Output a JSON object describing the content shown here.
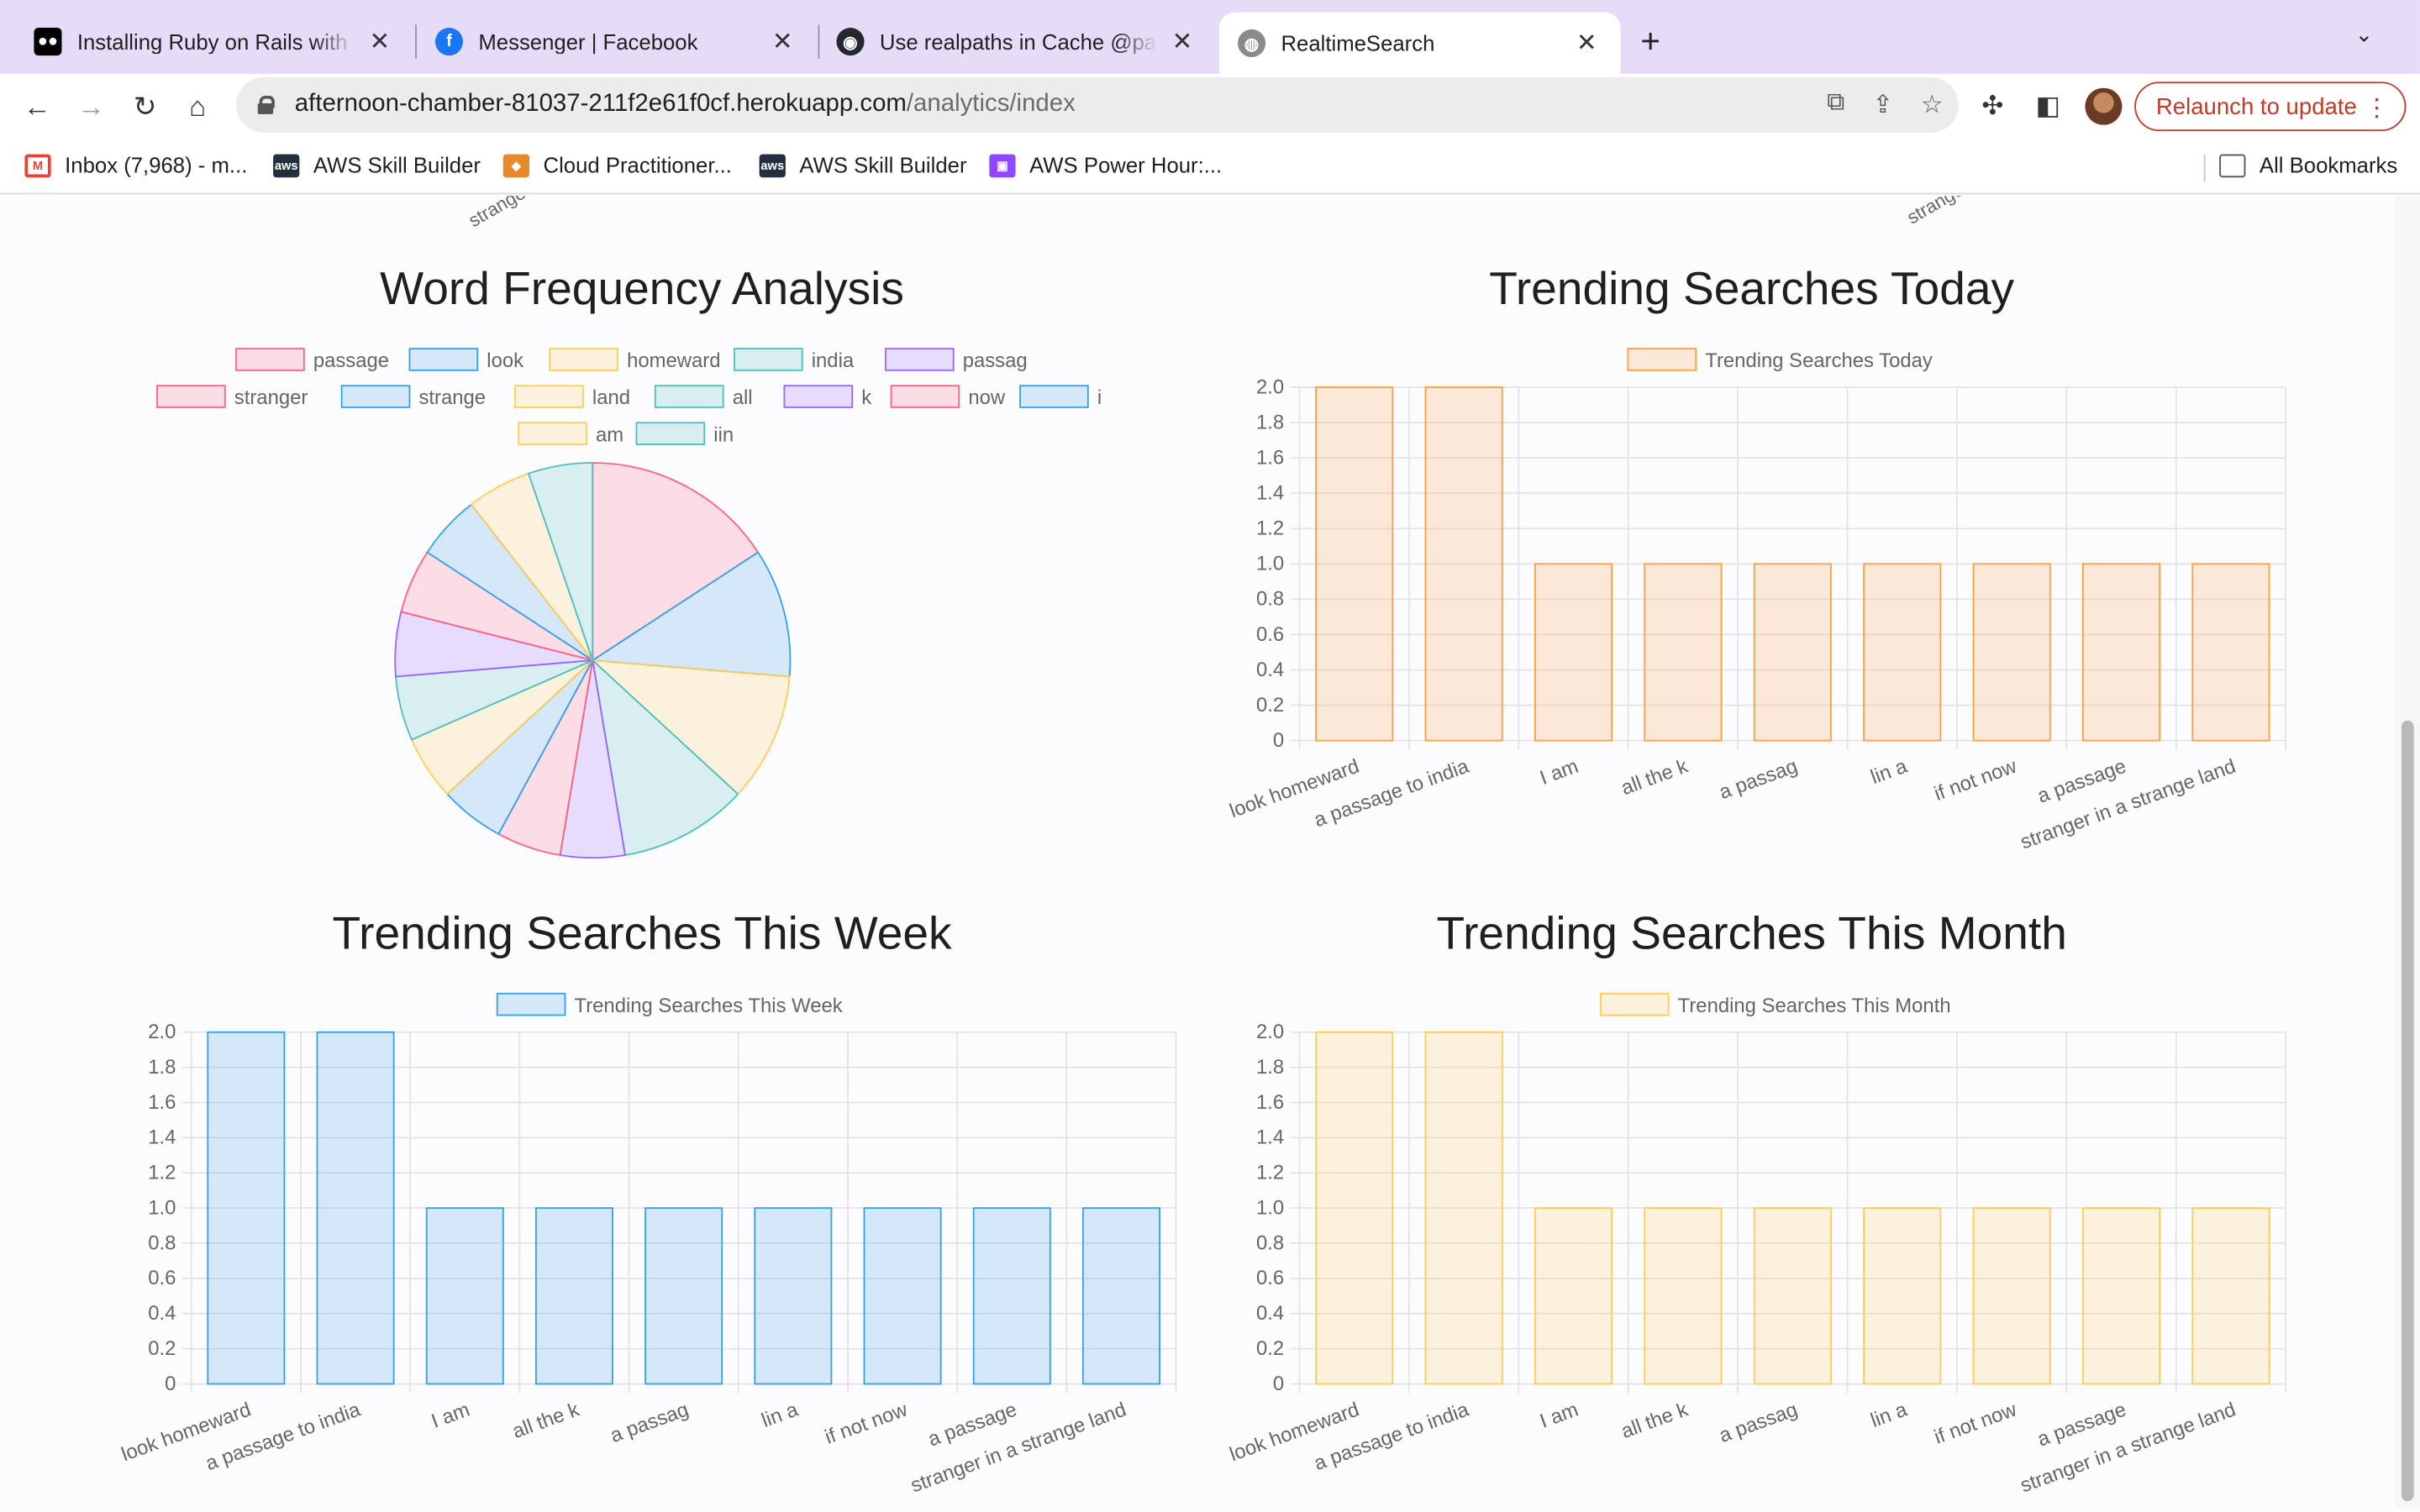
{
  "browser": {
    "tabs": [
      {
        "title": "Installing Ruby on Rails with cl",
        "icon": "medium-icon",
        "active": false
      },
      {
        "title": "Messenger | Facebook",
        "icon": "facebook-icon",
        "active": false
      },
      {
        "title": "Use realpaths in Cache @path",
        "icon": "github-icon",
        "active": false
      },
      {
        "title": "RealtimeSearch",
        "icon": "globe-icon",
        "active": true
      }
    ],
    "url_host": "afternoon-chamber-81037-211f2e61f0cf.herokuapp.com",
    "url_path": "/analytics/index",
    "relaunch_label": "Relaunch to update",
    "bookmarks": [
      {
        "label": "Inbox (7,968) - m...",
        "icon": "gmail-icon"
      },
      {
        "label": "AWS Skill Builder",
        "icon": "aws-icon"
      },
      {
        "label": "Cloud Practitioner...",
        "icon": "cube-icon"
      },
      {
        "label": "AWS Skill Builder",
        "icon": "aws-icon"
      },
      {
        "label": "AWS Power Hour:...",
        "icon": "twitch-icon"
      }
    ],
    "all_bookmarks_label": "All Bookmarks"
  },
  "page": {
    "cut_labels": [
      "strange",
      "strange"
    ],
    "charts": {
      "word_frequency_title": "Word Frequency Analysis",
      "today_title": "Trending Searches Today",
      "week_title": "Trending Searches This Week",
      "month_title": "Trending Searches This Month"
    }
  },
  "colors": {
    "red": "#ff6384",
    "blue": "#36a2eb",
    "yellow": "#ffcd56",
    "teal": "#4bc0c0",
    "purple": "#9966ff",
    "orange": "#ff9f40"
  },
  "chart_data": [
    {
      "type": "pie",
      "title": "Word Frequency Analysis",
      "legend_position": "top",
      "labels": [
        "passage",
        "look",
        "homeward",
        "india",
        "passag",
        "stranger",
        "strange",
        "land",
        "all",
        "k",
        "now",
        "i",
        "am",
        "iin"
      ],
      "values": [
        3,
        2,
        2,
        2,
        1,
        1,
        1,
        1,
        1,
        1,
        1,
        1,
        1,
        1
      ],
      "colors": [
        "red",
        "blue",
        "yellow",
        "teal",
        "purple",
        "red",
        "blue",
        "yellow",
        "teal",
        "purple",
        "red",
        "blue",
        "yellow",
        "teal"
      ]
    },
    {
      "type": "bar",
      "title": "Trending Searches Today",
      "series": [
        {
          "name": "Trending Searches Today",
          "color": "orange",
          "values": [
            2,
            2,
            1,
            1,
            1,
            1,
            1,
            1,
            1
          ]
        }
      ],
      "categories": [
        "look homeward",
        "a passage to india",
        "I am",
        "all the k",
        "a passag",
        "lin a",
        "if not now",
        "a passage",
        "stranger in a strange land"
      ],
      "y_ticks": [
        "0",
        "0.2",
        "0.4",
        "0.6",
        "0.8",
        "1.0",
        "1.2",
        "1.4",
        "1.6",
        "1.8",
        "2.0"
      ],
      "ylim": [
        0,
        2
      ],
      "grid": true
    },
    {
      "type": "bar",
      "title": "Trending Searches This Week",
      "series": [
        {
          "name": "Trending Searches This Week",
          "color": "blue",
          "values": [
            2,
            2,
            1,
            1,
            1,
            1,
            1,
            1,
            1
          ]
        }
      ],
      "categories": [
        "look homeward",
        "a passage to india",
        "I am",
        "all the k",
        "a passag",
        "lin a",
        "if not now",
        "a passage",
        "stranger in a strange land"
      ],
      "y_ticks": [
        "0",
        "0.2",
        "0.4",
        "0.6",
        "0.8",
        "1.0",
        "1.2",
        "1.4",
        "1.6",
        "1.8",
        "2.0"
      ],
      "ylim": [
        0,
        2
      ],
      "grid": true
    },
    {
      "type": "bar",
      "title": "Trending Searches This Month",
      "series": [
        {
          "name": "Trending Searches This Month",
          "color": "yellow",
          "values": [
            2,
            2,
            1,
            1,
            1,
            1,
            1,
            1,
            1
          ]
        }
      ],
      "categories": [
        "look homeward",
        "a passage to india",
        "I am",
        "all the k",
        "a passag",
        "lin a",
        "if not now",
        "a passage",
        "stranger in a strange land"
      ],
      "y_ticks": [
        "0",
        "0.2",
        "0.4",
        "0.6",
        "0.8",
        "1.0",
        "1.2",
        "1.4",
        "1.6",
        "1.8",
        "2.0"
      ],
      "ylim": [
        0,
        2
      ],
      "grid": true
    }
  ]
}
